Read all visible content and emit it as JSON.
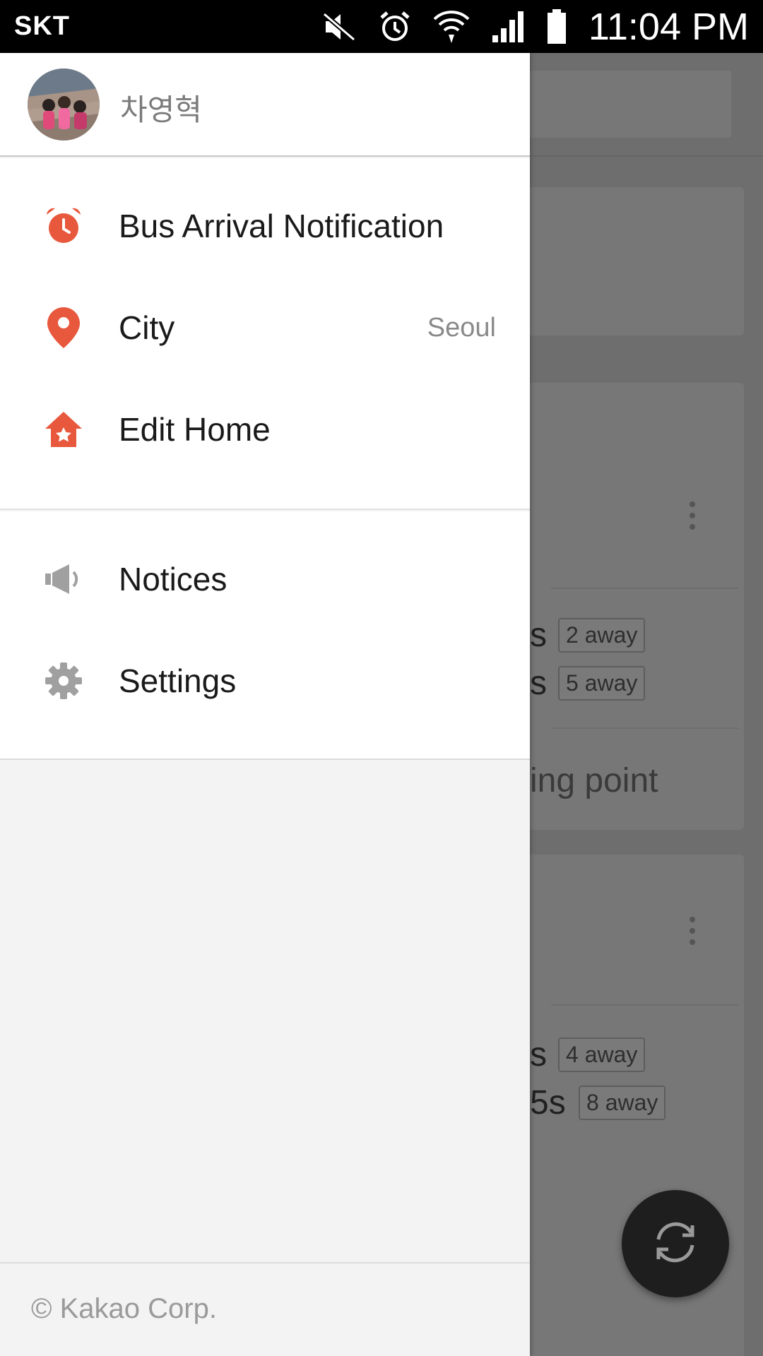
{
  "status_bar": {
    "carrier": "SKT",
    "time": "11:04 PM",
    "icons": [
      "mute-icon",
      "alarm-icon",
      "wifi-icon",
      "signal-icon",
      "battery-icon"
    ]
  },
  "drawer": {
    "user": {
      "name": "차영혁"
    },
    "menu": {
      "bus_arrival": {
        "label": "Bus Arrival Notification",
        "icon": "alarm-clock-icon"
      },
      "city": {
        "label": "City",
        "value": "Seoul",
        "icon": "map-pin-icon"
      },
      "edit_home": {
        "label": "Edit Home",
        "icon": "home-star-icon"
      },
      "notices": {
        "label": "Notices",
        "icon": "megaphone-icon"
      },
      "settings": {
        "label": "Settings",
        "icon": "gear-icon"
      }
    },
    "footer": {
      "copyright": "© Kakao Corp."
    }
  },
  "background": {
    "card1": {
      "rows": [
        {
          "text": "s",
          "badge": "2 away"
        },
        {
          "text": "s",
          "badge": "5 away"
        }
      ],
      "note": "ing point"
    },
    "card2": {
      "rows": [
        {
          "text": "s",
          "badge": "4 away"
        },
        {
          "text": "5s",
          "badge": "8 away"
        }
      ]
    }
  },
  "colors": {
    "accent": "#e8583c",
    "icon_gray": "#9e9e9e",
    "status_bar": "#000000",
    "fab": "#1e1e1e"
  }
}
